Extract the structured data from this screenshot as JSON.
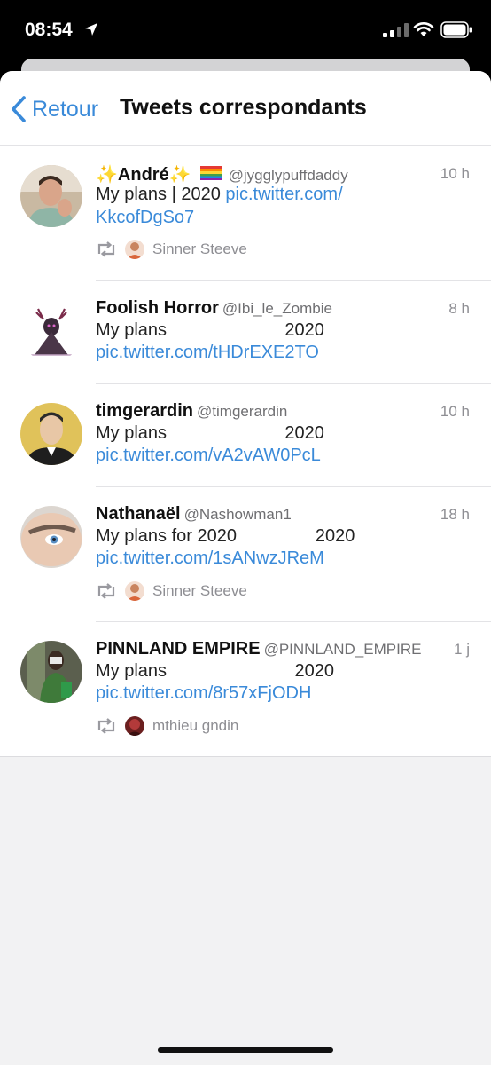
{
  "status_bar": {
    "time": "08:54"
  },
  "nav": {
    "back_label": "Retour",
    "title": "Tweets correspondants"
  },
  "tweets": [
    {
      "name": "André",
      "handle": "@jygglypuffdaddy",
      "time": "10 h",
      "text": "My plans | 2020 ",
      "link_part1": "pic.twitter.com/",
      "link_part2": "KkcofDgSo7",
      "retweeted_by": "Sinner Steeve"
    },
    {
      "name": "Foolish Horror",
      "handle": "@Ibi_le_Zombie",
      "time": "8 h",
      "text": "My plans                        2020",
      "link": "pic.twitter.com/tHDrEXE2TO"
    },
    {
      "name": "timgerardin",
      "handle": "@timgerardin",
      "time": "10 h",
      "text": "My plans                        2020",
      "link": "pic.twitter.com/vA2vAW0PcL"
    },
    {
      "name": "Nathanaël",
      "handle": "@Nashowman1",
      "time": "18 h",
      "text": "My plans for 2020                2020",
      "link": "pic.twitter.com/1sANwzJReM",
      "retweeted_by": "Sinner Steeve"
    },
    {
      "name": "PINNLAND EMPIRE",
      "handle": "@PINNLAND_EMPIRE",
      "time": "1 j",
      "text": "My plans                          2020",
      "link": "pic.twitter.com/8r57xFjODH",
      "retweeted_by": "mthieu gndin"
    }
  ],
  "colors": {
    "link": "#3a8ad9",
    "secondary_text": "#8e8e93",
    "sheet_background": "#f2f2f3"
  }
}
